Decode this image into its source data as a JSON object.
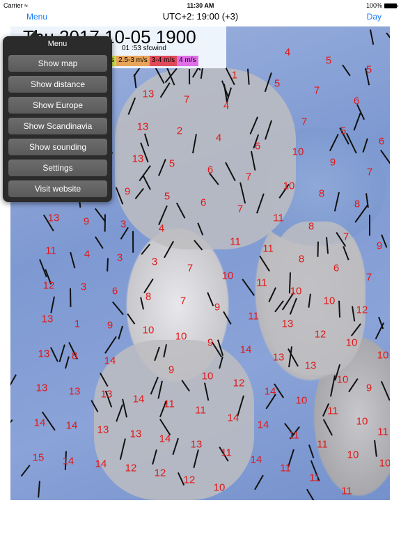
{
  "status_bar": {
    "carrier": "Carrier",
    "wifi_icon": "wifi-icon",
    "time": "11:30 AM",
    "battery": "100%",
    "battery_icon": "battery-icon"
  },
  "nav": {
    "menu_label": "Menu",
    "title": "UTC+2: 19:00 (+3)",
    "day_label": "Day"
  },
  "map": {
    "header_date": "Thu 2017 10-05   1900",
    "header_sub": "01 :53   sfcwind",
    "legend": [
      {
        "label": "m/s",
        "color": "#d4e84a"
      },
      {
        "label": "2.5-3 m/s",
        "color": "#e8a55a"
      },
      {
        "label": "3-4 m/s",
        "color": "#e04a5a"
      },
      {
        "label": "4 m/s",
        "color": "#e070e8"
      }
    ],
    "number_color": "#e01818",
    "values": [
      1,
      4,
      5,
      5,
      5,
      7,
      6,
      4,
      7,
      13,
      13,
      2,
      4,
      6,
      7,
      5,
      6,
      13,
      5,
      6,
      7,
      10,
      9,
      7,
      9,
      5,
      6,
      10,
      8,
      8,
      13,
      9,
      3,
      4,
      7,
      11,
      8,
      7,
      9,
      11,
      4,
      3,
      3,
      7,
      11,
      11,
      8,
      6,
      7,
      12,
      3,
      6,
      8,
      7,
      9,
      10,
      11,
      10,
      10,
      12,
      13,
      1,
      9,
      10,
      10,
      9,
      11,
      13,
      12,
      10,
      13,
      8,
      14,
      9,
      10,
      14,
      13,
      13,
      10,
      10,
      13,
      13,
      13,
      14,
      11,
      11,
      12,
      14,
      10,
      11,
      9,
      14,
      14,
      13,
      13,
      14,
      13,
      14,
      14,
      11,
      10,
      15,
      14,
      14,
      12,
      12,
      12,
      11,
      14,
      11,
      11,
      10,
      10,
      10,
      11,
      11,
      11
    ]
  },
  "menu": {
    "title": "Menu",
    "items": [
      "Show map",
      "Show distance",
      "Show Europe",
      "Show Scandinavia",
      "Show sounding",
      "Settings",
      "Visit website"
    ]
  }
}
